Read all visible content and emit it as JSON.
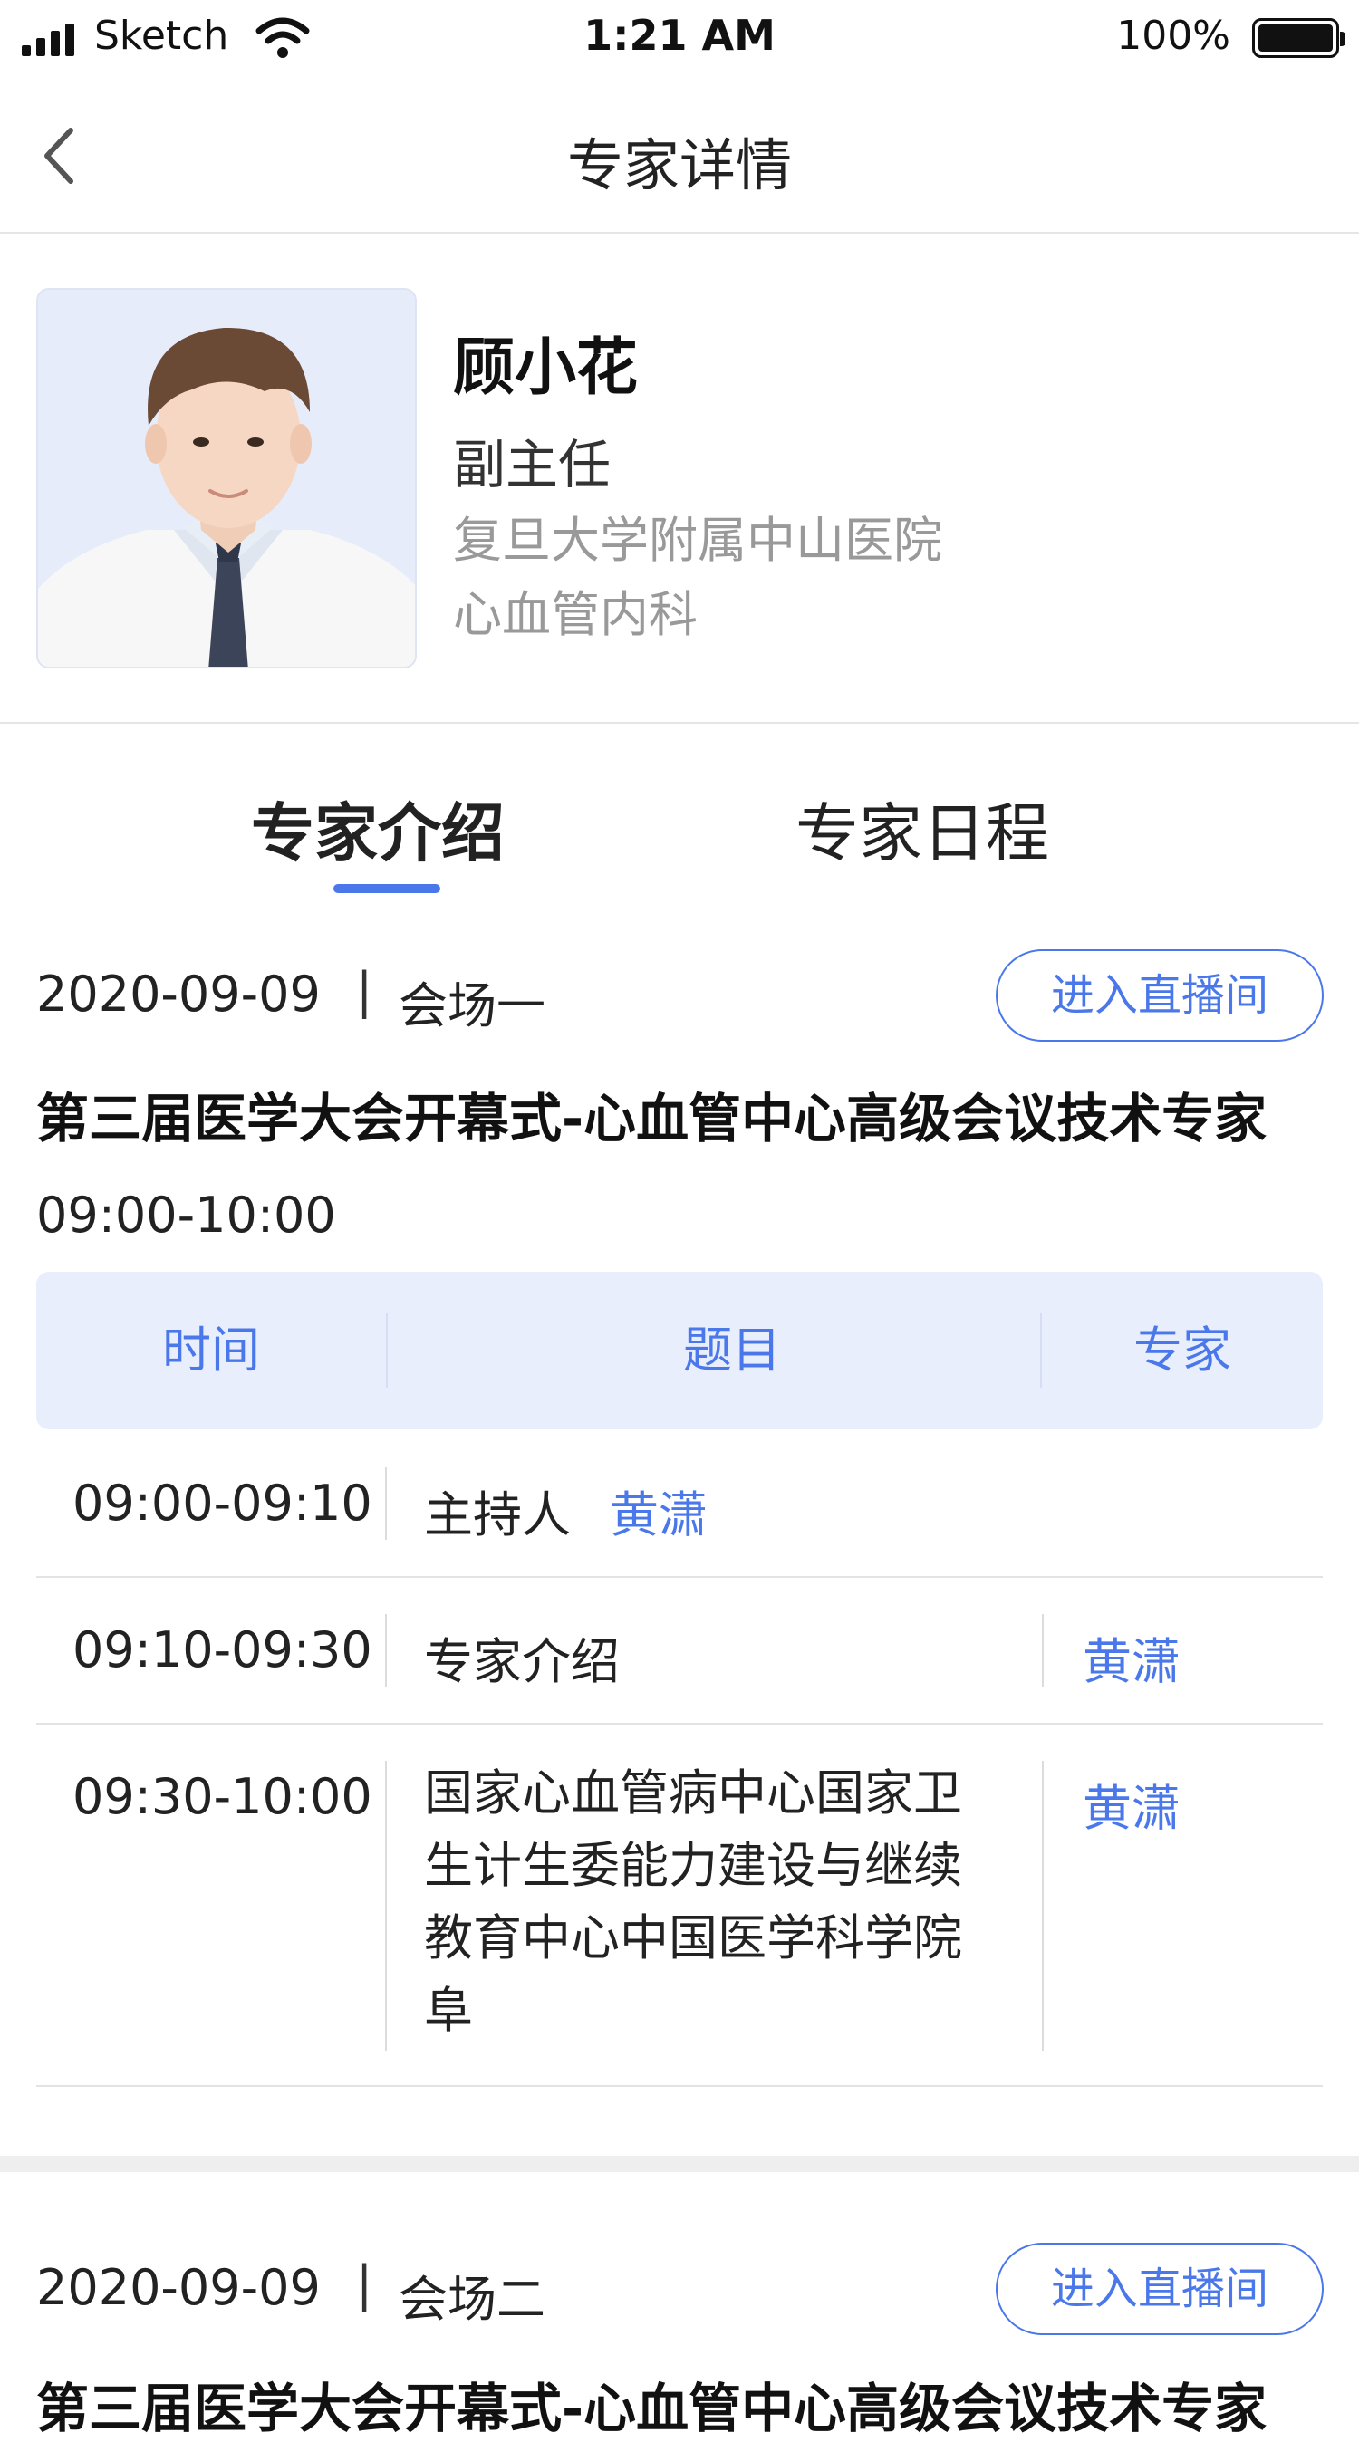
{
  "status_bar": {
    "carrier": "Sketch",
    "time": "1:21 AM",
    "battery": "100%"
  },
  "nav": {
    "title": "专家详情"
  },
  "profile": {
    "name": "顾小花",
    "position": "副主任",
    "hospital": "复旦大学附属中山医院",
    "department": "心血管内科"
  },
  "tabs": [
    {
      "label": "专家介绍",
      "active": true
    },
    {
      "label": "专家日程",
      "active": false
    }
  ],
  "sessions": [
    {
      "date": "2020-09-09",
      "separator": "|",
      "venue": "会场一",
      "live_button": "进入直播间",
      "title": "第三届医学大会开幕式-心血管中心高级会议技术专家",
      "time": "09:00-10:00",
      "table": {
        "headers": [
          "时间",
          "题目",
          "专家"
        ],
        "rows": [
          {
            "time": "09:00-09:10",
            "topic": "主持人",
            "host": "黄潇",
            "expert": ""
          },
          {
            "time": "09:10-09:30",
            "topic": "专家介绍",
            "host": "",
            "expert": "黄潇"
          },
          {
            "time": "09:30-10:00",
            "topic": [
              "国家心血管病中心国家卫",
              "生计生委能力建设与继续",
              "教育中心中国医学科学院",
              "阜"
            ],
            "host": "",
            "expert": "黄潇"
          }
        ]
      }
    },
    {
      "date": "2020-09-09",
      "separator": "|",
      "venue": "会场二",
      "live_button": "进入直播间",
      "title": "第三届医学大会开幕式-心血管中心高级会议技术专家"
    }
  ],
  "colors": {
    "accent": "#4a78ea",
    "table_header_bg": "#e9eefc"
  }
}
